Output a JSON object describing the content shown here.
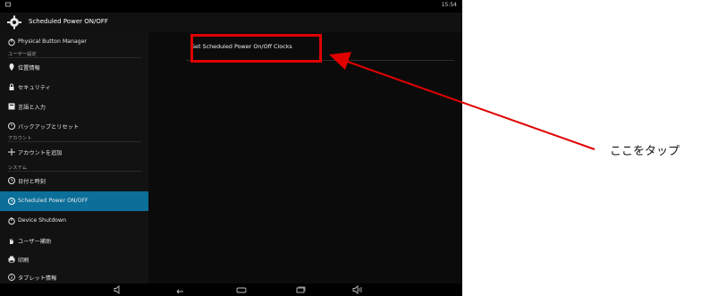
{
  "status_bar": {
    "time": "15:54"
  },
  "header": {
    "title": "Scheduled Power ON/OFF"
  },
  "sidebar": {
    "items": [
      {
        "label": "Physical Button Manager",
        "icon": "power-icon"
      },
      {
        "label": "位置情報",
        "icon": "location-icon"
      },
      {
        "label": "セキュリティ",
        "icon": "lock-icon"
      },
      {
        "label": "言語と入力",
        "icon": "keyboard-icon"
      },
      {
        "label": "バックアップとリセット",
        "icon": "backup-icon"
      },
      {
        "label": "アカウントを追加",
        "icon": "plus-icon"
      },
      {
        "label": "日付と時刻",
        "icon": "clock-icon"
      },
      {
        "label": "Scheduled Power ON/OFF",
        "icon": "clock-icon"
      },
      {
        "label": "Device Shutdown",
        "icon": "power-icon"
      },
      {
        "label": "ユーザー補助",
        "icon": "hand-icon"
      },
      {
        "label": "印刷",
        "icon": "printer-icon"
      },
      {
        "label": "タブレット情報",
        "icon": "info-icon"
      }
    ],
    "sections": [
      "ユーザー設定",
      "アカウント",
      "システム"
    ]
  },
  "content": {
    "option": "Set Scheduled Power On/Off Clocks"
  },
  "annotation": {
    "callout": "ここをタップ",
    "color": "#e00000"
  },
  "colors": {
    "accent": "#0c6f9a",
    "background": "#000000"
  }
}
